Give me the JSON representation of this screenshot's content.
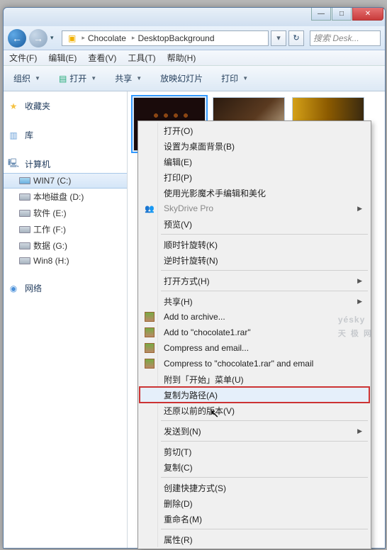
{
  "titlebar": {
    "min": "—",
    "max": "□",
    "close": "✕"
  },
  "nav": {
    "back": "←",
    "fwd": "→",
    "drop": "▾",
    "crumb1": "Chocolate",
    "crumb2": "DesktopBackground",
    "sep": "▸",
    "refresh": "↻",
    "search_placeholder": "搜索 Desk..."
  },
  "menubar": {
    "file": "文件(F)",
    "edit": "编辑(E)",
    "view": "查看(V)",
    "tools": "工具(T)",
    "help": "帮助(H)"
  },
  "toolbar": {
    "organize": "组织",
    "open": "打开",
    "share": "共享",
    "slideshow": "放映幻灯片",
    "print": "打印",
    "drop": "▼"
  },
  "sidebar": {
    "favorites": "收藏夹",
    "libraries": "库",
    "computer": "计算机",
    "drives": [
      {
        "label": "WIN7 (C:)"
      },
      {
        "label": "本地磁盘 (D:)"
      },
      {
        "label": "软件 (E:)"
      },
      {
        "label": "工作 (F:)"
      },
      {
        "label": "数据 (G:)"
      },
      {
        "label": "Win8 (H:)"
      }
    ],
    "network": "网络"
  },
  "context_menu": {
    "groups": [
      [
        {
          "label": "打开(O)"
        },
        {
          "label": "设置为桌面背景(B)"
        },
        {
          "label": "编辑(E)"
        },
        {
          "label": "打印(P)"
        },
        {
          "label": "使用光影魔术手编辑和美化"
        },
        {
          "label": "SkyDrive Pro",
          "submenu": true,
          "disabled": true,
          "icon": "skydrive"
        },
        {
          "label": "预览(V)"
        }
      ],
      [
        {
          "label": "顺时针旋转(K)"
        },
        {
          "label": "逆时针旋转(N)"
        }
      ],
      [
        {
          "label": "打开方式(H)",
          "submenu": true
        }
      ],
      [
        {
          "label": "共享(H)",
          "submenu": true
        },
        {
          "label": "Add to archive...",
          "icon": "rar"
        },
        {
          "label": "Add to \"chocolate1.rar\"",
          "icon": "rar"
        },
        {
          "label": "Compress and email...",
          "icon": "rar"
        },
        {
          "label": "Compress to \"chocolate1.rar\" and email",
          "icon": "rar"
        },
        {
          "label": "附到「开始」菜单(U)"
        },
        {
          "label": "复制为路径(A)",
          "highlighted": true
        },
        {
          "label": "还原以前的版本(V)"
        }
      ],
      [
        {
          "label": "发送到(N)",
          "submenu": true
        }
      ],
      [
        {
          "label": "剪切(T)"
        },
        {
          "label": "复制(C)"
        }
      ],
      [
        {
          "label": "创建快捷方式(S)"
        },
        {
          "label": "删除(D)"
        },
        {
          "label": "重命名(M)"
        }
      ],
      [
        {
          "label": "属性(R)"
        }
      ]
    ]
  },
  "watermark": {
    "brand": "yésky",
    "sub": "天 极 网"
  }
}
